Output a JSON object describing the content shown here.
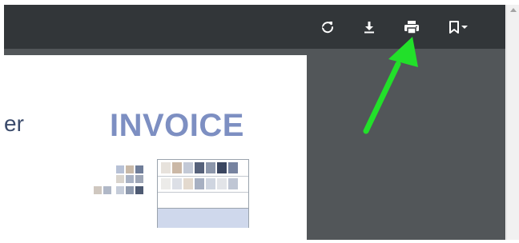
{
  "toolbar": {
    "buttons": [
      {
        "name": "rotate-button",
        "icon": "rotate-icon"
      },
      {
        "name": "download-button",
        "icon": "download-icon"
      },
      {
        "name": "print-button",
        "icon": "print-icon"
      },
      {
        "name": "bookmark-button",
        "icon": "bookmark-icon"
      }
    ]
  },
  "document": {
    "sender_fragment": "er",
    "title": "INVOICE"
  },
  "annotation": {
    "arrow_color": "#22e02a",
    "target": "print-button"
  },
  "colors": {
    "toolbar_bg": "#323639",
    "viewer_bg": "#525659",
    "title_color": "#7d8fc2"
  }
}
